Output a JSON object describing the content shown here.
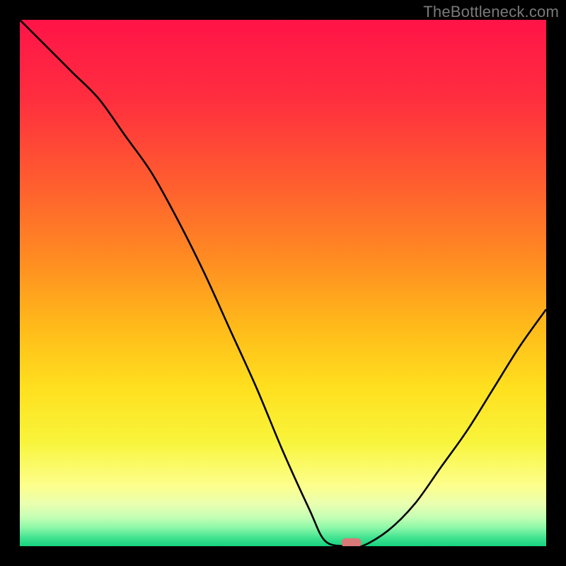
{
  "watermark": "TheBottleneck.com",
  "chart_data": {
    "type": "line",
    "title": "",
    "xlabel": "",
    "ylabel": "",
    "xlim": [
      0,
      100
    ],
    "ylim": [
      0,
      100
    ],
    "grid": false,
    "x": [
      0,
      5,
      10,
      15,
      20,
      25,
      30,
      35,
      40,
      45,
      50,
      55,
      58,
      62,
      65,
      70,
      75,
      80,
      85,
      90,
      95,
      100
    ],
    "values": [
      100,
      95,
      90,
      85,
      78,
      71,
      62,
      52,
      41,
      30,
      18,
      7,
      1,
      0,
      0,
      3,
      8,
      15,
      22,
      30,
      38,
      45
    ],
    "marker": {
      "x": 63,
      "y": 0.7
    },
    "gradient_stops": [
      {
        "pos": 0.0,
        "color": "#ff1448"
      },
      {
        "pos": 0.15,
        "color": "#ff2e3f"
      },
      {
        "pos": 0.3,
        "color": "#ff5a30"
      },
      {
        "pos": 0.45,
        "color": "#ff8a22"
      },
      {
        "pos": 0.58,
        "color": "#ffb91a"
      },
      {
        "pos": 0.7,
        "color": "#ffe01f"
      },
      {
        "pos": 0.8,
        "color": "#f8f43a"
      },
      {
        "pos": 0.885,
        "color": "#fdff8c"
      },
      {
        "pos": 0.92,
        "color": "#e9ffb0"
      },
      {
        "pos": 0.945,
        "color": "#c4ffb4"
      },
      {
        "pos": 0.965,
        "color": "#8cf7a8"
      },
      {
        "pos": 0.985,
        "color": "#3de28f"
      },
      {
        "pos": 1.0,
        "color": "#17d27e"
      }
    ]
  }
}
